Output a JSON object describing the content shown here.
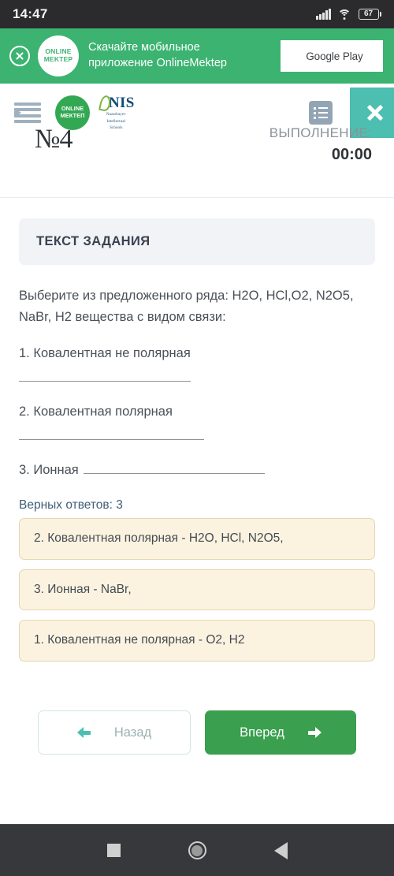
{
  "status_bar": {
    "time": "14:47",
    "battery_level": "67",
    "signal_icon": "cellular-signal-icon",
    "wifi_icon": "wifi-icon",
    "battery_icon": "battery-icon"
  },
  "promo_banner": {
    "close_icon": "close-circle-icon",
    "logo_line1": "ONLINE",
    "logo_line2": "MEKTEP",
    "text_line1": "Скачайте мобильное",
    "text_line2": "приложение OnlineMektep",
    "store_button_label": "Google Play",
    "background_color": "#3cb371"
  },
  "app_header": {
    "menu_icon": "hamburger-menu-icon",
    "om_logo_line1": "ONLINE",
    "om_logo_line2": "МЕКТЕП",
    "nis_logo_text": "NIS",
    "nis_logo_sub1": "Nazarbayev",
    "nis_logo_sub2": "Intellectual",
    "nis_logo_sub3": "Schools",
    "list_icon": "list-view-icon",
    "close_icon": "close-icon",
    "close_button_color": "#4cbfb0",
    "question_number": "№4",
    "timer_label": "ВЫПОЛНЕНИЕ:",
    "timer_value": "00:00"
  },
  "task": {
    "band_title": "ТЕКСТ ЗАДАНИЯ",
    "prompt": "Выберите из предложенного ряда: H2O, HCl,O2, N2O5, NaBr, H2 вещества с видом связи:",
    "items": [
      "1. Ковалентная не полярная",
      "2. Ковалентная полярная",
      "3. Ионная"
    ],
    "correct_answers_label": "Верных ответов: 3",
    "answers": [
      "2. Ковалентная полярная - H2O, HCl, N2O5,",
      "3. Ионная - NaBr,",
      "1. Ковалентная не полярная - O2, H2"
    ],
    "answer_card_bg": "#fbf3e0",
    "answer_card_border": "#e6d6b0"
  },
  "navigation": {
    "back_label": "Назад",
    "next_label": "Вперед",
    "back_arrow_icon": "arrow-left-icon",
    "next_arrow_icon": "arrow-right-icon",
    "next_color": "#3a9f4e"
  },
  "android_nav": {
    "recents_icon": "square-recents-icon",
    "home_icon": "circle-home-icon",
    "back_icon": "triangle-back-icon"
  }
}
